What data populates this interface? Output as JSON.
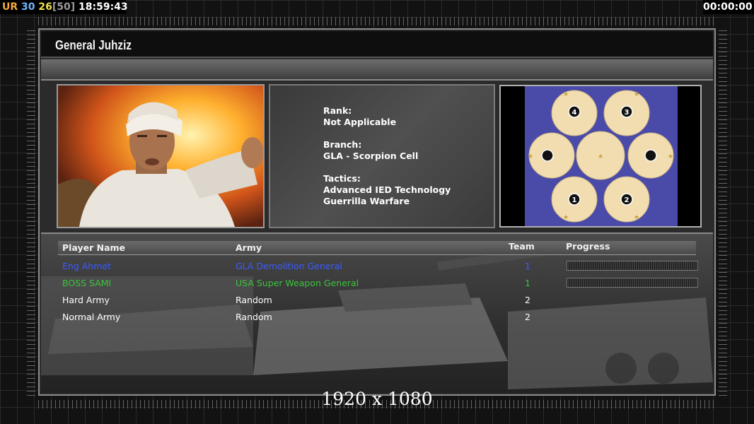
{
  "hud": {
    "ur": "UR",
    "val1": "30",
    "val2": "26",
    "val3": "[50]",
    "clock": "18:59:43",
    "timer": "00:00:00"
  },
  "general": {
    "title": "General Juhziz",
    "rank_label": "Rank:",
    "rank_value": "Not Applicable",
    "branch_label": "Branch:",
    "branch_value": "GLA - Scorpion Cell",
    "tactics_label": "Tactics:",
    "tactics": [
      "Advanced IED Technology",
      "Guerrilla Warfare"
    ]
  },
  "minimap": {
    "slots": [
      "1",
      "2",
      "3",
      "4"
    ]
  },
  "table": {
    "headers": {
      "name": "Player Name",
      "army": "Army",
      "team": "Team",
      "progress": "Progress"
    },
    "rows": [
      {
        "name": "Eng Ahmet",
        "army": "GLA Demolition General",
        "team": "1",
        "color": "#3b5bff",
        "has_progress": true
      },
      {
        "name": "BOSS SAMI",
        "army": "USA Super Weapon General",
        "team": "1",
        "color": "#3cc23c",
        "has_progress": true
      },
      {
        "name": "Hard Army",
        "army": "Random",
        "team": "2",
        "color": "#ffffff",
        "has_progress": false
      },
      {
        "name": "Normal Army",
        "army": "Random",
        "team": "2",
        "color": "#ffffff",
        "has_progress": false
      }
    ]
  },
  "resolution": "1920 x 1080"
}
